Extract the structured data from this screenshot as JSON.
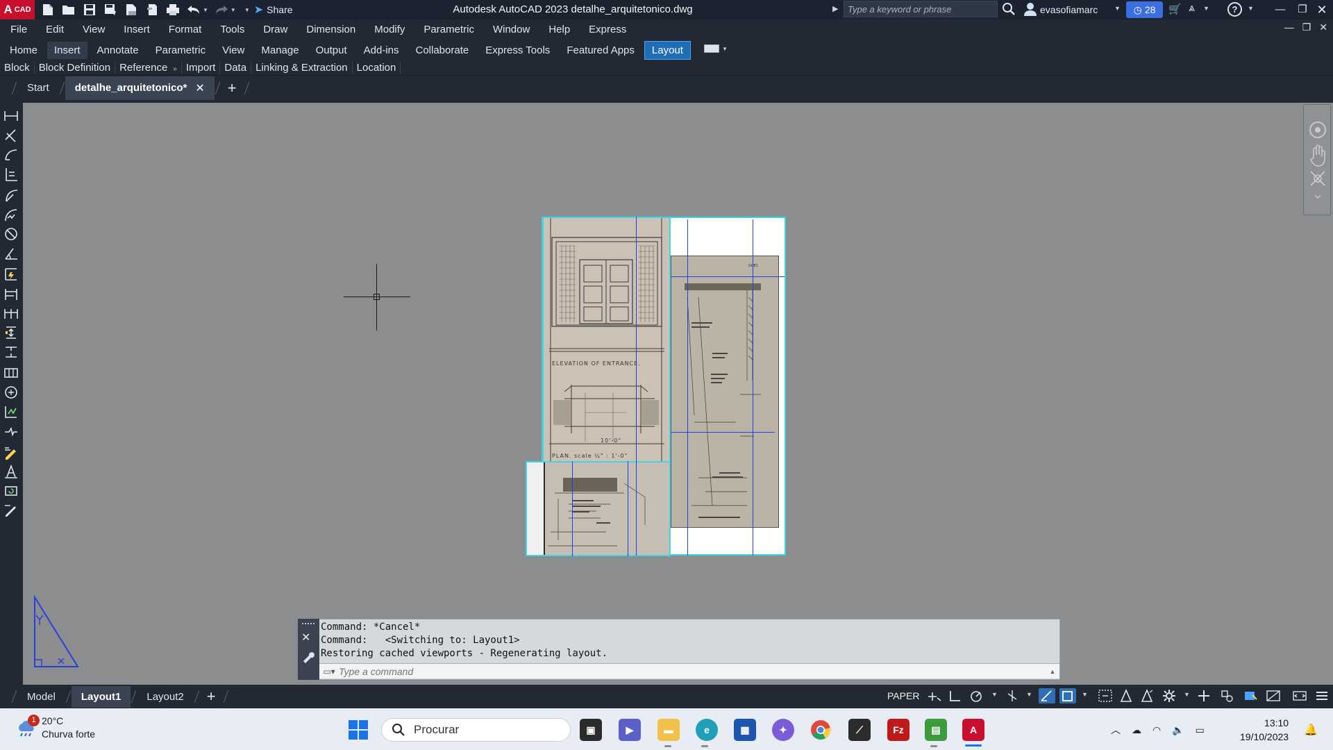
{
  "app": {
    "logo_letter": "A",
    "logo_sub": "CAD",
    "window_title": "Autodesk AutoCAD 2023   detalhe_arquitetonico.dwg",
    "share_label": "Share",
    "search_placeholder": "Type a keyword or phrase",
    "user_name": "evasofiamarc",
    "trial_days": "28"
  },
  "quick_access": [
    "new-file-icon",
    "open-folder-icon",
    "save-icon",
    "save-as-icon",
    "export-icon",
    "publish-icon",
    "print-icon",
    "undo-icon",
    "redo-icon"
  ],
  "menu": [
    "File",
    "Edit",
    "View",
    "Insert",
    "Format",
    "Tools",
    "Draw",
    "Dimension",
    "Modify",
    "Parametric",
    "Window",
    "Help",
    "Express"
  ],
  "ribbon_tabs": [
    "Home",
    "Insert",
    "Annotate",
    "Parametric",
    "View",
    "Manage",
    "Output",
    "Add-ins",
    "Collaborate",
    "Express Tools",
    "Featured Apps",
    "Layout"
  ],
  "ribbon_active": "Insert",
  "panels": [
    "Block",
    "Block Definition",
    "Reference",
    "Import",
    "Data",
    "Linking & Extraction",
    "Location"
  ],
  "doc_tabs": {
    "start": "Start",
    "active": "detalhe_arquitetonico*"
  },
  "drawing": {
    "entrance_label": "ELEVATION  OF  ENTRANCE.",
    "plan_label": "PLAN.   scale  ¼\" : 1'-0\"",
    "dimension": "10'-0\""
  },
  "command": {
    "history": [
      "Command: *Cancel*",
      "Command:   <Switching to: Layout1>",
      "Restoring cached viewports - Regenerating layout."
    ],
    "placeholder": "Type a command"
  },
  "layout_tabs": [
    "Model",
    "Layout1",
    "Layout2"
  ],
  "layout_active": "Layout1",
  "status": {
    "space": "PAPER"
  },
  "taskbar": {
    "weather_temp": "20°C",
    "weather_desc": "Churva forte",
    "weather_badge": "1",
    "search_label": "Procurar",
    "time": "13:10",
    "date": "19/10/2023"
  },
  "colors": {
    "accent": "#1f6db5",
    "viewport_border": "#3fd6ea",
    "guide_line": "#2040e0",
    "canvas": "#8b8d8f"
  }
}
